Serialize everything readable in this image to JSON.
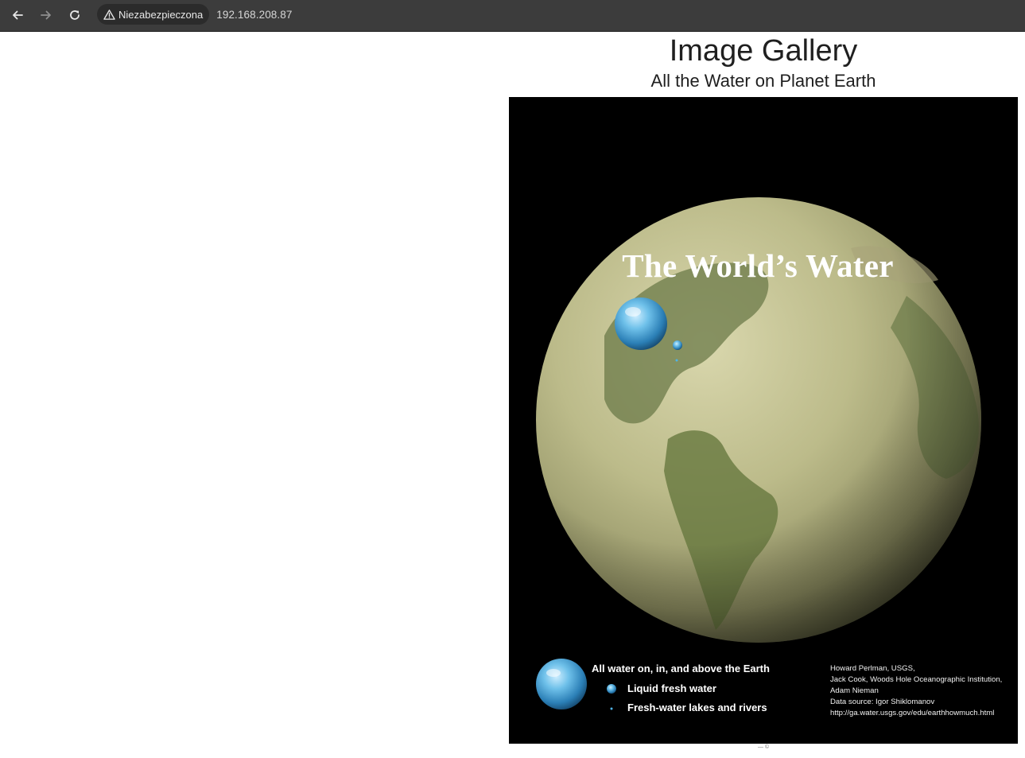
{
  "browser": {
    "security_label": "Niezabezpieczona",
    "url": "192.168.208.87"
  },
  "page": {
    "title": "Image Gallery",
    "caption": "All the Water on Planet Earth",
    "footer": "— ©"
  },
  "poster": {
    "title": "The World’s Water",
    "legend": {
      "all_water": "All water on, in, and above the Earth",
      "fresh_water": "Liquid fresh water",
      "lakes_rivers": "Fresh-water lakes and rivers"
    },
    "credits": [
      "Howard Perlman, USGS,",
      "Jack Cook, Woods Hole Oceanographic Institution,",
      "Adam Nieman",
      "Data source: Igor Shiklomanov",
      "http://ga.water.usgs.gov/edu/earthhowmuch.html"
    ]
  },
  "icons": [
    "back-arrow-icon",
    "forward-arrow-icon",
    "reload-icon",
    "warning-triangle-icon"
  ]
}
